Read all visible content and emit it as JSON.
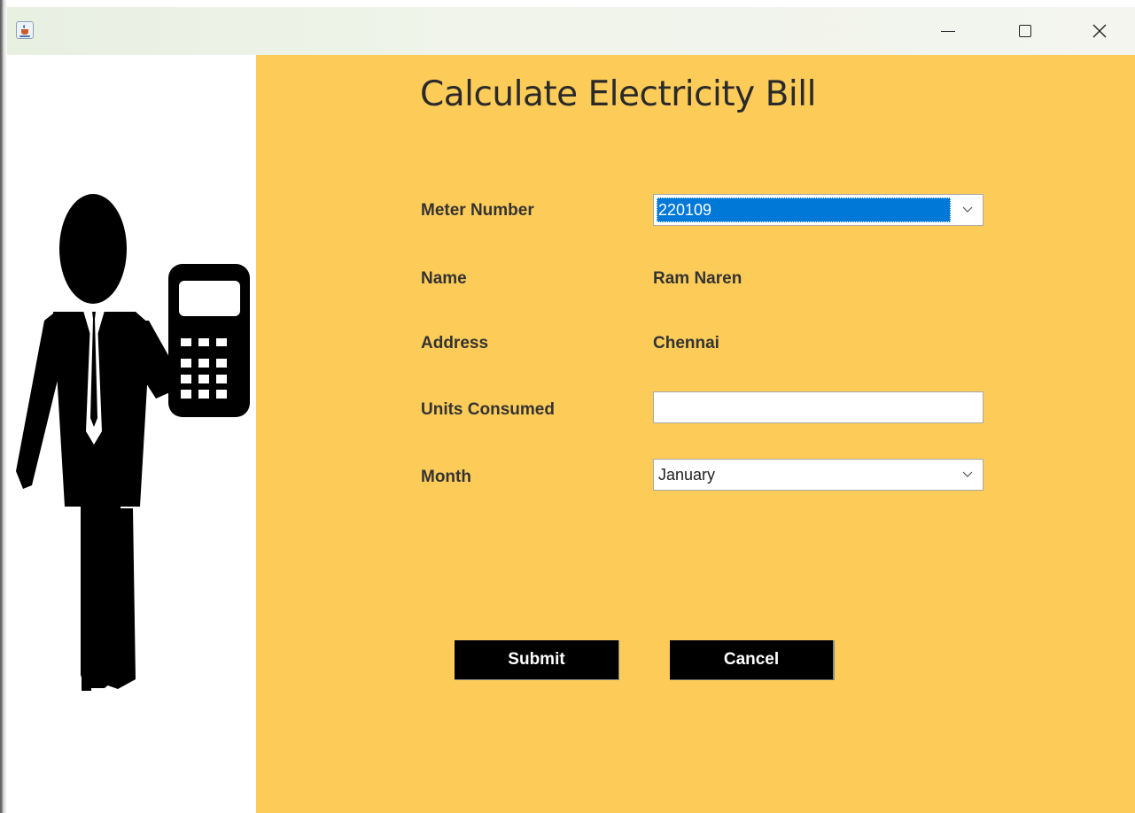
{
  "window": {
    "minimize_icon": "minimize-icon",
    "maximize_icon": "maximize-icon",
    "close_icon": "close-icon",
    "app_icon": "java-cup-icon"
  },
  "colors": {
    "panel_background": "#fdcc58",
    "selection": "#0078d7",
    "button_background": "#000000",
    "button_text": "#ffffff"
  },
  "illustration": "businessman-with-calculator",
  "form": {
    "title": "Calculate Electricity Bill",
    "meter_number": {
      "label": "Meter Number",
      "selected": "220109"
    },
    "name": {
      "label": "Name",
      "value": "Ram Naren"
    },
    "address": {
      "label": "Address",
      "value": "Chennai"
    },
    "units_consumed": {
      "label": "Units Consumed",
      "value": ""
    },
    "month": {
      "label": "Month",
      "selected": "January"
    },
    "submit_label": "Submit",
    "cancel_label": "Cancel"
  }
}
